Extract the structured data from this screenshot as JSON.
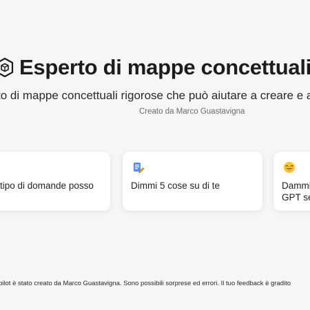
{
  "header": {
    "title": "Esperto di mappe concettuali",
    "subtitle": "to di mappe concettuali rigorose che può aiutare a creare e analiz",
    "author": "Creato da Marco Guastavigna"
  },
  "suggestions": [
    {
      "label": "tipo di domande posso",
      "icon": "none"
    },
    {
      "label": "Dimmi 5 cose su di te",
      "icon": "notepad-pencil-icon"
    },
    {
      "label": "Dammi GPT se",
      "icon": "grinning-face-icon"
    }
  ],
  "footer": {
    "disclaimer": "bilot è stato creato da Marco Guastavigna. Sono possibili sorprese ed errori. Il tuo feedback è gradito"
  },
  "colors": {
    "background": "#f6f6f6",
    "card": "#ffffff",
    "text": "#1f1f1f",
    "muted": "#6b6b6b"
  }
}
